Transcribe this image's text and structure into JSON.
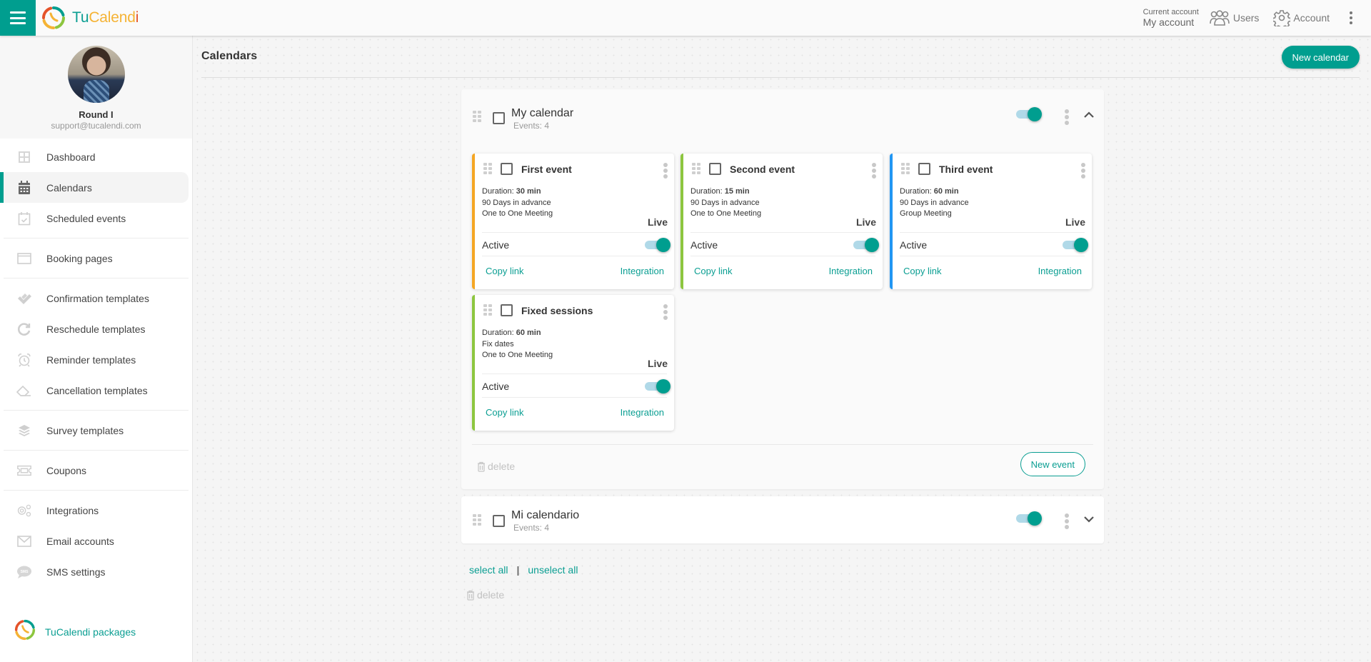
{
  "app": {
    "brand_part1": "Tu",
    "brand_part2": "Calend",
    "brand_part3": "i",
    "brand_colors": {
      "teal": "#009e8f",
      "yellow": "#f5b335",
      "red": "#e5532a",
      "green": "#8dc63f"
    }
  },
  "topbar": {
    "menu_icon": "hamburger-icon",
    "current_account_label": "Current account",
    "current_account_value": "My account",
    "users_label": "Users",
    "users_icon": "users-icon",
    "account_label": "Account",
    "account_icon": "gear-icon",
    "more_icon": "kebab-icon"
  },
  "sidebar": {
    "profile": {
      "name": "Round I",
      "email": "support@tucalendi.com"
    },
    "items": [
      {
        "label": "Dashboard",
        "icon": "dashboard-icon",
        "active": false
      },
      {
        "label": "Calendars",
        "icon": "calendar-icon",
        "active": true
      },
      {
        "label": "Scheduled events",
        "icon": "calendar-check-icon",
        "active": false
      },
      {
        "label": "Booking pages",
        "icon": "browser-window-icon",
        "active": false
      },
      {
        "label": "Confirmation templates",
        "icon": "double-check-icon",
        "active": false
      },
      {
        "label": "Reschedule templates",
        "icon": "redo-icon",
        "active": false
      },
      {
        "label": "Reminder templates",
        "icon": "alarm-clock-icon",
        "active": false
      },
      {
        "label": "Cancellation templates",
        "icon": "eraser-icon",
        "active": false
      },
      {
        "label": "Survey templates",
        "icon": "layers-icon",
        "active": false
      },
      {
        "label": "Coupons",
        "icon": "ticket-icon",
        "active": false
      },
      {
        "label": "Integrations",
        "icon": "gears-icon",
        "active": false
      },
      {
        "label": "Email accounts",
        "icon": "envelope-icon",
        "active": false
      },
      {
        "label": "SMS settings",
        "icon": "sms-bubble-icon",
        "active": false
      }
    ],
    "packages_label": "TuCalendi packages"
  },
  "main": {
    "title": "Calendars",
    "new_calendar_label": "New calendar",
    "calendars": [
      {
        "name": "My calendar",
        "events_count": "Events: 4",
        "enabled": true,
        "expanded": true,
        "events": [
          {
            "title": "First event",
            "duration_label": "Duration:",
            "duration": "30 min",
            "line2": "90 Days in advance",
            "line3": "One to One Meeting",
            "status": "Live",
            "active_label": "Active",
            "active": true,
            "copy_link": "Copy link",
            "integration": "Integration",
            "color": "#f5a623"
          },
          {
            "title": "Second event",
            "duration_label": "Duration:",
            "duration": "15 min",
            "line2": "90 Days in advance",
            "line3": "One to One Meeting",
            "status": "Live",
            "active_label": "Active",
            "active": true,
            "copy_link": "Copy link",
            "integration": "Integration",
            "color": "#8dc63f"
          },
          {
            "title": "Third event",
            "duration_label": "Duration:",
            "duration": "60 min",
            "line2": "90 Days in advance",
            "line3": "Group Meeting",
            "status": "Live",
            "active_label": "Active",
            "active": true,
            "copy_link": "Copy link",
            "integration": "Integration",
            "color": "#2196f3"
          },
          {
            "title": "Fixed sessions",
            "duration_label": "Duration:",
            "duration": "60 min",
            "line2": "Fix dates",
            "line3": "One to One Meeting",
            "status": "Live",
            "active_label": "Active",
            "active": true,
            "copy_link": "Copy link",
            "integration": "Integration",
            "color": "#8dc63f"
          }
        ],
        "delete_label": "delete",
        "new_event_label": "New event"
      },
      {
        "name": "Mi calendario",
        "events_count": "Events: 4",
        "enabled": true,
        "expanded": false
      }
    ],
    "select_all_label": "select all",
    "separator": "|",
    "unselect_all_label": "unselect all",
    "bulk_delete_label": "delete"
  }
}
